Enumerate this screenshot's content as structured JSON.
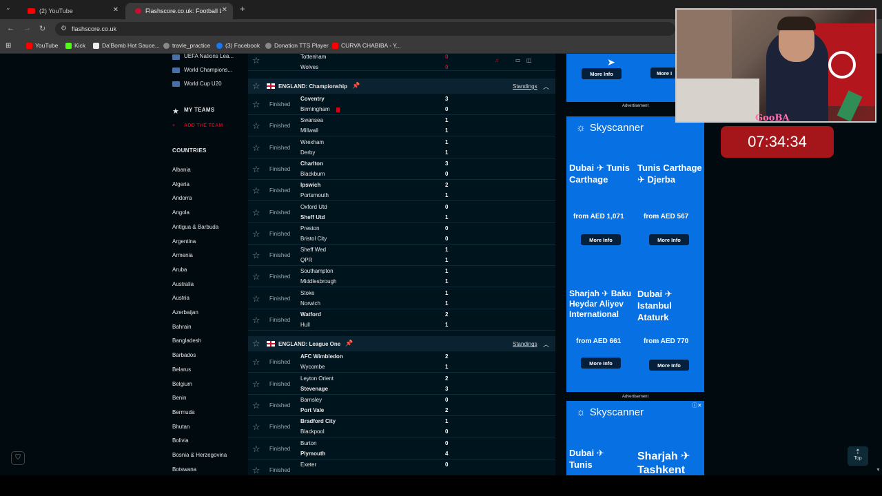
{
  "browser": {
    "tabs": [
      {
        "label": "(2) YouTube",
        "active": false
      },
      {
        "label": "Flashscore.co.uk: Football Live S",
        "active": true
      }
    ],
    "new_tab": "+",
    "url": "flashscore.co.uk",
    "bookmarks": [
      "YouTube",
      "Kick",
      "Da'Bomb Hot Sauce...",
      "travle_practice",
      "(3) Facebook",
      "Donation TTS Player",
      "CURVA CHABIBA - Y..."
    ]
  },
  "sidebar": {
    "competitions": [
      "UEFA Nations Lea...",
      "World Champions...",
      "World Cup U20"
    ],
    "my_teams_header": "MY TEAMS",
    "add_team": "ADD THE TEAM",
    "countries_header": "COUNTRIES",
    "countries": [
      "Albania",
      "Algeria",
      "Andorra",
      "Angola",
      "Antigua & Barbuda",
      "Argentina",
      "Armenia",
      "Aruba",
      "Australia",
      "Austria",
      "Azerbaijan",
      "Bahrain",
      "Bangladesh",
      "Barbados",
      "Belarus",
      "Belgium",
      "Benin",
      "Bermuda",
      "Bhutan",
      "Bolivia",
      "Bosnia & Herzegovina",
      "Botswana"
    ]
  },
  "matches": {
    "top_partial": {
      "team1": "Tottenham",
      "score1": "0",
      "team2": "Wolves",
      "score2": "0"
    },
    "leagues": [
      {
        "name": "ENGLAND: Championship",
        "standings": "Standings",
        "rows": [
          {
            "status": "Finished",
            "team1": "Coventry",
            "score1": "3",
            "team2": "Birmingham",
            "score2": "0",
            "w": 1,
            "card": true
          },
          {
            "status": "Finished",
            "team1": "Swansea",
            "score1": "1",
            "team2": "Millwall",
            "score2": "1",
            "w": 0
          },
          {
            "status": "Finished",
            "team1": "Wrexham",
            "score1": "1",
            "team2": "Derby",
            "score2": "1",
            "w": 0
          },
          {
            "status": "Finished",
            "team1": "Charlton",
            "score1": "3",
            "team2": "Blackburn",
            "score2": "0",
            "w": 1
          },
          {
            "status": "Finished",
            "team1": "Ipswich",
            "score1": "2",
            "team2": "Portsmouth",
            "score2": "1",
            "w": 1
          },
          {
            "status": "Finished",
            "team1": "Oxford Utd",
            "score1": "0",
            "team2": "Sheff Utd",
            "score2": "1",
            "w": 2
          },
          {
            "status": "Finished",
            "team1": "Preston",
            "score1": "0",
            "team2": "Bristol City",
            "score2": "0",
            "w": 0
          },
          {
            "status": "Finished",
            "team1": "Sheff Wed",
            "score1": "1",
            "team2": "QPR",
            "score2": "1",
            "w": 0
          },
          {
            "status": "Finished",
            "team1": "Southampton",
            "score1": "1",
            "team2": "Middlesbrough",
            "score2": "1",
            "w": 0
          },
          {
            "status": "Finished",
            "team1": "Stoke",
            "score1": "1",
            "team2": "Norwich",
            "score2": "1",
            "w": 0
          },
          {
            "status": "Finished",
            "team1": "Watford",
            "score1": "2",
            "team2": "Hull",
            "score2": "1",
            "w": 1
          }
        ]
      },
      {
        "name": "ENGLAND: League One",
        "standings": "Standings",
        "rows": [
          {
            "status": "Finished",
            "team1": "AFC Wimbledon",
            "score1": "2",
            "team2": "Wycombe",
            "score2": "1",
            "w": 1
          },
          {
            "status": "Finished",
            "team1": "Leyton Orient",
            "score1": "2",
            "team2": "Stevenage",
            "score2": "3",
            "w": 2
          },
          {
            "status": "Finished",
            "team1": "Barnsley",
            "score1": "0",
            "team2": "Port Vale",
            "score2": "2",
            "w": 2
          },
          {
            "status": "Finished",
            "team1": "Bradford City",
            "score1": "1",
            "team2": "Blackpool",
            "score2": "0",
            "w": 1
          },
          {
            "status": "Finished",
            "team1": "Burton",
            "score1": "0",
            "team2": "Plymouth",
            "score2": "4",
            "w": 2
          },
          {
            "status": "Finished",
            "team1": "Exeter",
            "score1": "0",
            "team2": "",
            "score2": "",
            "w": 0
          }
        ]
      }
    ]
  },
  "ads": {
    "label": "Advertisement",
    "brand": "Skyscanner",
    "more_info": "More Info",
    "top_more_1": "More Info",
    "top_more_2": "More I",
    "offers": [
      {
        "dest": "Dubai ✈ Tunis Carthage",
        "price": "from AED 1,071"
      },
      {
        "dest": "Tunis Carthage ✈ Djerba",
        "price": "from AED 567"
      },
      {
        "dest": "Sharjah ✈ Baku Heydar Aliyev International",
        "price": "from AED 661"
      },
      {
        "dest": "Dubai ✈ Istanbul Ataturk",
        "price": "from AED 770"
      }
    ],
    "second_offers": [
      "Dubai ✈ Tunis",
      "Sharjah ✈ Tashkent"
    ]
  },
  "stream": {
    "tag": "GooBA",
    "timer": "07:34:34"
  },
  "top_button": "Top"
}
